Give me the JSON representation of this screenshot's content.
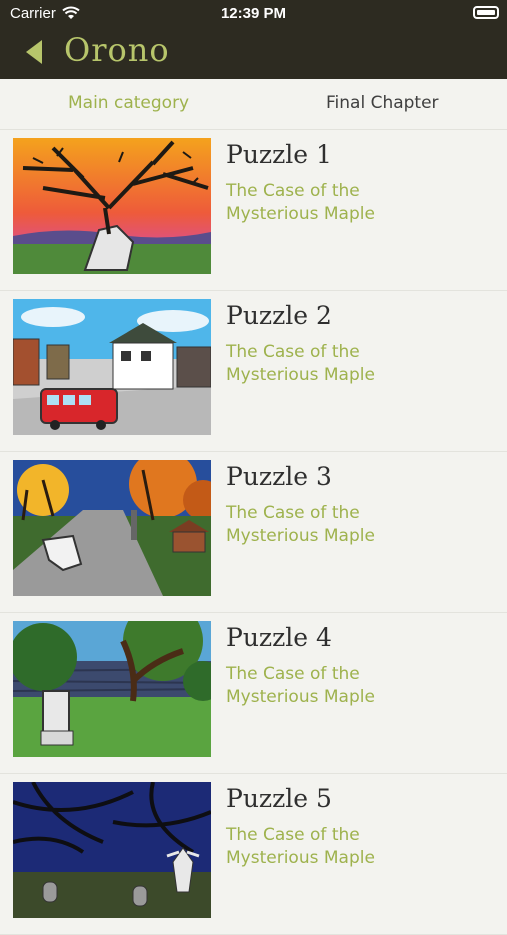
{
  "status_bar": {
    "carrier": "Carrier",
    "time": "12:39 PM"
  },
  "nav": {
    "title": "Orono"
  },
  "tabs": [
    {
      "label": "Main category"
    },
    {
      "label": "Final Chapter"
    }
  ],
  "puzzles": [
    {
      "title": "Puzzle 1",
      "subtitle": "The Case of the Mysterious Maple"
    },
    {
      "title": "Puzzle 2",
      "subtitle": "The Case of the Mysterious Maple"
    },
    {
      "title": "Puzzle 3",
      "subtitle": "The Case of the Mysterious Maple"
    },
    {
      "title": "Puzzle 4",
      "subtitle": "The Case of the Mysterious Maple"
    },
    {
      "title": "Puzzle 5",
      "subtitle": "The Case of the Mysterious Maple"
    }
  ],
  "colors": {
    "bar": "#2d2b21",
    "accent": "#9eb24d",
    "title_accent": "#b7c56b"
  }
}
